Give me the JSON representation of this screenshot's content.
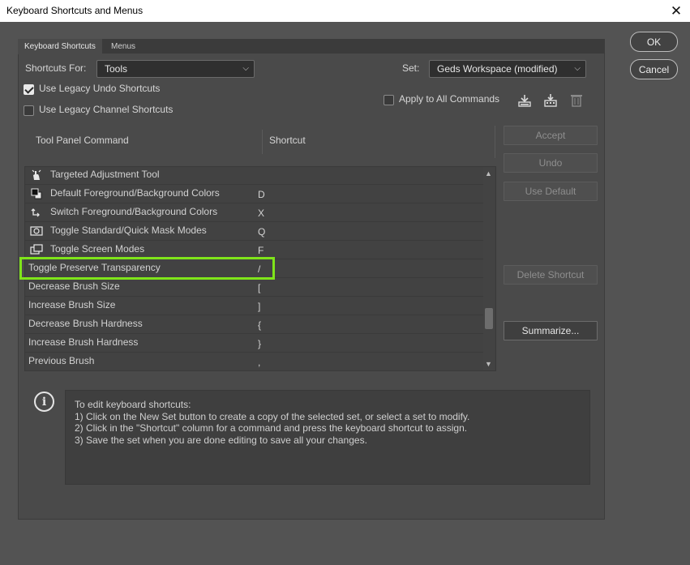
{
  "window": {
    "title": "Keyboard Shortcuts and Menus",
    "close_glyph": "✕"
  },
  "tabs": [
    {
      "label": "Keyboard Shortcuts",
      "active": true
    },
    {
      "label": "Menus",
      "active": false
    }
  ],
  "shortcuts_for": {
    "label": "Shortcuts For:",
    "value": "Tools"
  },
  "set": {
    "label": "Set:",
    "value": "Geds Workspace (modified)"
  },
  "checkboxes": {
    "legacy_undo": {
      "label": "Use Legacy Undo Shortcuts",
      "checked": true
    },
    "legacy_channel": {
      "label": "Use Legacy Channel Shortcuts",
      "checked": false
    },
    "apply_all": {
      "label": "Apply to All Commands",
      "checked": false
    }
  },
  "table": {
    "col_command": "Tool Panel Command",
    "col_shortcut": "Shortcut",
    "rows": [
      {
        "command": "Targeted Adjustment Tool",
        "shortcut": "",
        "icon": "hand-adjust-icon"
      },
      {
        "command": "Default Foreground/Background Colors",
        "shortcut": "D",
        "icon": "default-colors-icon"
      },
      {
        "command": "Switch Foreground/Background Colors",
        "shortcut": "X",
        "icon": "swap-colors-icon"
      },
      {
        "command": "Toggle Standard/Quick Mask Modes",
        "shortcut": "Q",
        "icon": "quick-mask-icon"
      },
      {
        "command": "Toggle Screen Modes",
        "shortcut": "F",
        "icon": "screen-mode-icon"
      },
      {
        "command": "Toggle Preserve Transparency",
        "shortcut": "/",
        "icon": ""
      },
      {
        "command": "Decrease Brush Size",
        "shortcut": "[",
        "icon": ""
      },
      {
        "command": "Increase Brush Size",
        "shortcut": "]",
        "icon": ""
      },
      {
        "command": "Decrease Brush Hardness",
        "shortcut": "{",
        "icon": ""
      },
      {
        "command": "Increase Brush Hardness",
        "shortcut": "}",
        "icon": ""
      },
      {
        "command": "Previous Brush",
        "shortcut": ",",
        "icon": ""
      }
    ]
  },
  "side_buttons": {
    "accept": "Accept",
    "undo": "Undo",
    "use_default": "Use Default",
    "delete_shortcut": "Delete Shortcut",
    "summarize": "Summarize..."
  },
  "dialog_buttons": {
    "ok": "OK",
    "cancel": "Cancel"
  },
  "info": {
    "lines": [
      "To edit keyboard shortcuts:",
      "1) Click on the New Set button to create a copy of the selected set, or select a set to modify.",
      "2) Click in the \"Shortcut\" column for a command and press the keyboard shortcut to assign.",
      "3) Save the set when you are done editing to save all your changes."
    ]
  },
  "colors": {
    "highlight": "#7fe41a",
    "panel": "#4a4a4a",
    "background": "#535353"
  }
}
